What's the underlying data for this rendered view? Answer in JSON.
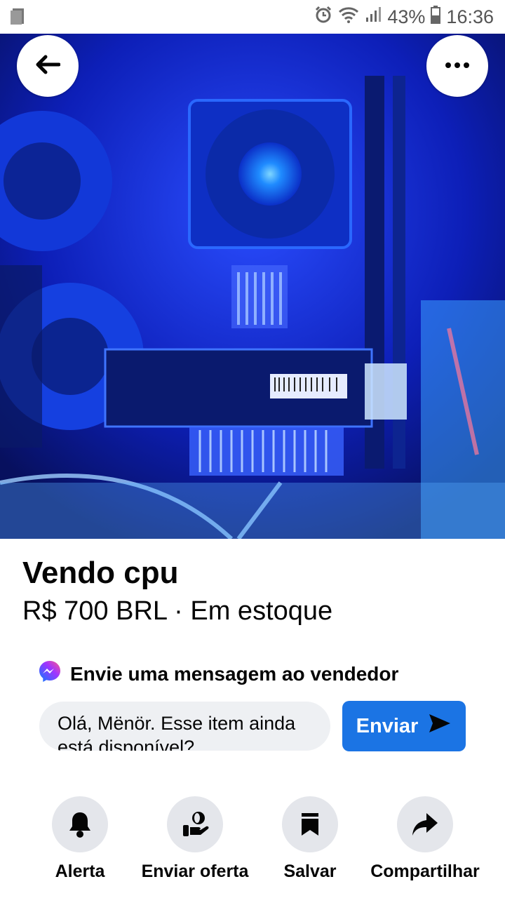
{
  "status_bar": {
    "battery": "43%",
    "time": "16:36"
  },
  "listing": {
    "title": "Vendo cpu",
    "price_line": "R$ 700 BRL · Em estoque"
  },
  "message": {
    "header": "Envie uma mensagem ao vendedor",
    "input_value": "Olá, Mënör. Esse item ainda está disponível?",
    "send_label": "Enviar"
  },
  "actions": [
    {
      "label": "Alerta",
      "icon": "bell-icon"
    },
    {
      "label": "Enviar oferta",
      "icon": "offer-icon"
    },
    {
      "label": "Salvar",
      "icon": "bookmark-icon"
    },
    {
      "label": "Compartilhar",
      "icon": "share-icon"
    }
  ],
  "colors": {
    "accent": "#1b74e4",
    "light_gray": "#e4e6eb"
  }
}
